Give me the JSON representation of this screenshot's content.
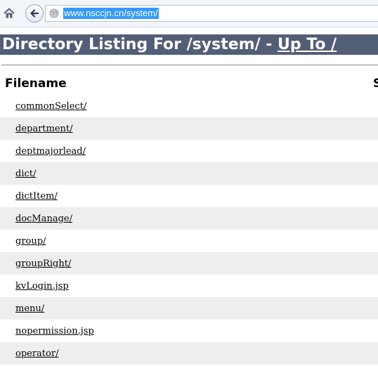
{
  "browser": {
    "url": "www.nsccjn.cn/system/"
  },
  "page": {
    "heading_prefix": "Directory Listing For /system/ - ",
    "heading_link": "Up To /",
    "columns": {
      "filename": "Filename",
      "size_partial": "S"
    },
    "files": [
      "commonSelect/",
      "department/",
      "deptmajorlead/",
      "dict/",
      "dictItem/",
      "docManage/",
      "group/",
      "groupRight/",
      "kvLogin.jsp",
      "menu/",
      "nopermission.jsp",
      "operator/"
    ]
  },
  "colors": {
    "header_bg": "#525d76",
    "row_alt": "#eeeeee",
    "url_highlight": "#3399ff"
  }
}
